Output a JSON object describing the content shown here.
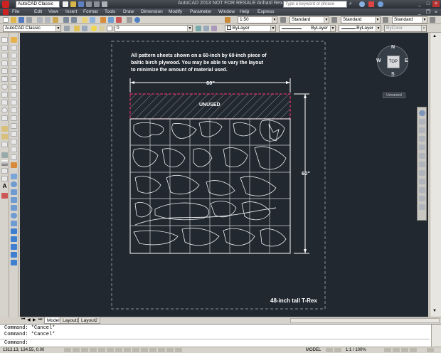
{
  "titlebar": {
    "workspace": "AutoCAD Classic",
    "title": "AutoCAD 2013   NOT FOR RESALE   Anhanl Rex40.dwg",
    "search_placeholder": "Type a keyword or phrase"
  },
  "menu": [
    "File",
    "Edit",
    "View",
    "Insert",
    "Format",
    "Tools",
    "Draw",
    "Dimension",
    "Modify",
    "Parameter",
    "Window",
    "Help",
    "Express"
  ],
  "toolbar": {
    "workspace_combo": "AutoCAD Classic",
    "layer_combo": "0",
    "annotation_scale": "1:50",
    "text_style": "Standard",
    "dim_style": "Standard",
    "table_style": "Standard",
    "multileader_style": "Standard",
    "color_combo": "ByLayer",
    "linetype_combo": "ByLayer",
    "lineweight_combo": "ByLayer",
    "plotstyle_combo": "ByColor"
  },
  "drawing": {
    "note_lines": [
      "All pattern sheets shown on a 60-inch by 60-inch piece of",
      "baltic birch plywood.  You may be able to vary the layout",
      "to minimize the amount of material used."
    ],
    "width_label": "60\"",
    "height_label": "60\"",
    "unused_label": "UNUSED",
    "caption": "48-inch tall T-Rex"
  },
  "viewcube": {
    "top_face": "TOP",
    "north": "N",
    "south": "S",
    "east": "E",
    "west": "W",
    "ucs_label": "Unnamed"
  },
  "layout_tabs": [
    "Model",
    "Layout1",
    "Layout2"
  ],
  "command_history": [
    "Command: *Cancel*",
    "Command: *Cancel*"
  ],
  "command_prompt": "Command:",
  "status": {
    "coordinates": "1312.13, 134.55, 0.00",
    "space": "MODEL",
    "scale": "1:1 / 100%"
  }
}
